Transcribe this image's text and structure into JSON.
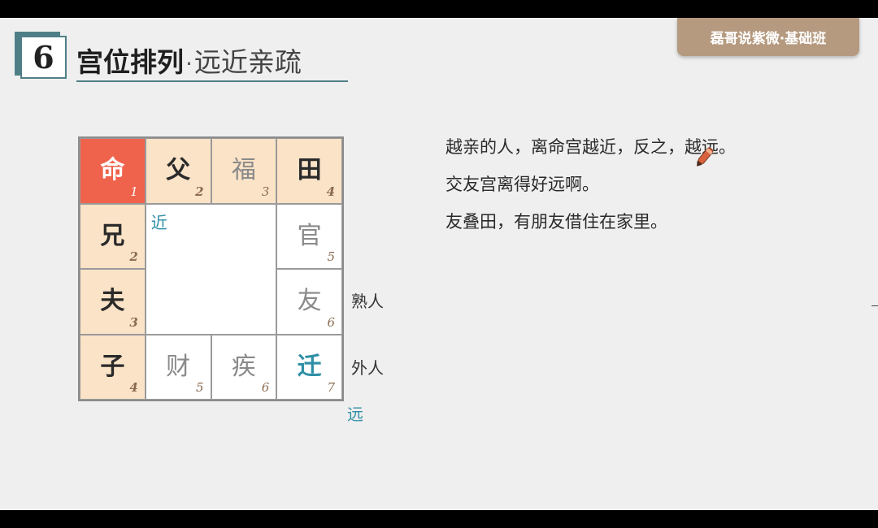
{
  "brand": {
    "label": "磊哥说紫微·基础班"
  },
  "section": {
    "number": "6",
    "title_main": "宫位排列",
    "title_dot": "·",
    "title_sub": "远近亲疏"
  },
  "grid": {
    "cells": [
      {
        "char": "命",
        "num": "1"
      },
      {
        "char": "父",
        "num": "2"
      },
      {
        "char": "福",
        "num": "3"
      },
      {
        "char": "田",
        "num": "4"
      },
      {
        "char": "兄",
        "num": "2"
      },
      {
        "char": "官",
        "num": "5"
      },
      {
        "char": "夫",
        "num": "3"
      },
      {
        "char": "友",
        "num": "6"
      },
      {
        "char": "子",
        "num": "4"
      },
      {
        "char": "财",
        "num": "5"
      },
      {
        "char": "疾",
        "num": "6"
      },
      {
        "char": "迁",
        "num": "7"
      }
    ],
    "near_label": "近",
    "far_label": "远",
    "acquaintance_label": "熟人",
    "outsider_label": "外人"
  },
  "notes": [
    "越亲的人，离命宫越近，反之，越远。",
    "交友宫离得好远啊。",
    "友叠田，有朋友借住在家里。"
  ],
  "colors": {
    "accent": "#4f7f86",
    "ming_red": "#ef624c",
    "beige": "#fbe3c7",
    "teal": "#2f8fa6",
    "brand_bg": "#b59a7f"
  },
  "icons": {
    "cursor": "pen-icon"
  }
}
